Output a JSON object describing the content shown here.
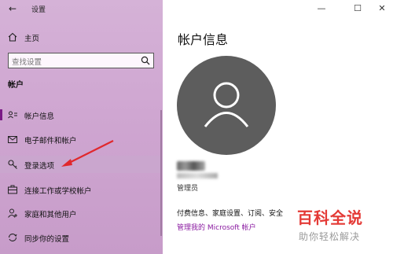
{
  "window": {
    "title": "设置",
    "back_glyph": "←",
    "minimize_glyph": "—",
    "maximize_glyph": "☐",
    "close_glyph": "✕"
  },
  "sidebar": {
    "home_label": "主页",
    "search_placeholder": "查找设置",
    "section_title": "帐户",
    "items": [
      {
        "label": "帐户信息",
        "icon": "account-info-icon"
      },
      {
        "label": "电子邮件和帐户",
        "icon": "mail-icon"
      },
      {
        "label": "登录选项",
        "icon": "key-icon"
      },
      {
        "label": "连接工作或学校帐户",
        "icon": "briefcase-icon"
      },
      {
        "label": "家庭和其他用户",
        "icon": "person-add-icon"
      },
      {
        "label": "同步你的设置",
        "icon": "sync-icon"
      }
    ]
  },
  "main": {
    "title": "帐户信息",
    "role": "管理员",
    "billing_text": "付费信息、家庭设置、订阅、安全",
    "ms_account_link": "管理我的 Microsoft 帐户"
  },
  "watermark": {
    "title": "百科全说",
    "subtitle": "助你轻松解决"
  },
  "colors": {
    "sidebar_bg": "#cfa6d1",
    "accent": "#7a1a86",
    "link": "#8a1aa0",
    "avatar_bg": "#5d5d5d",
    "arrow": "#e0282d",
    "watermark_red": "#e43a36"
  }
}
